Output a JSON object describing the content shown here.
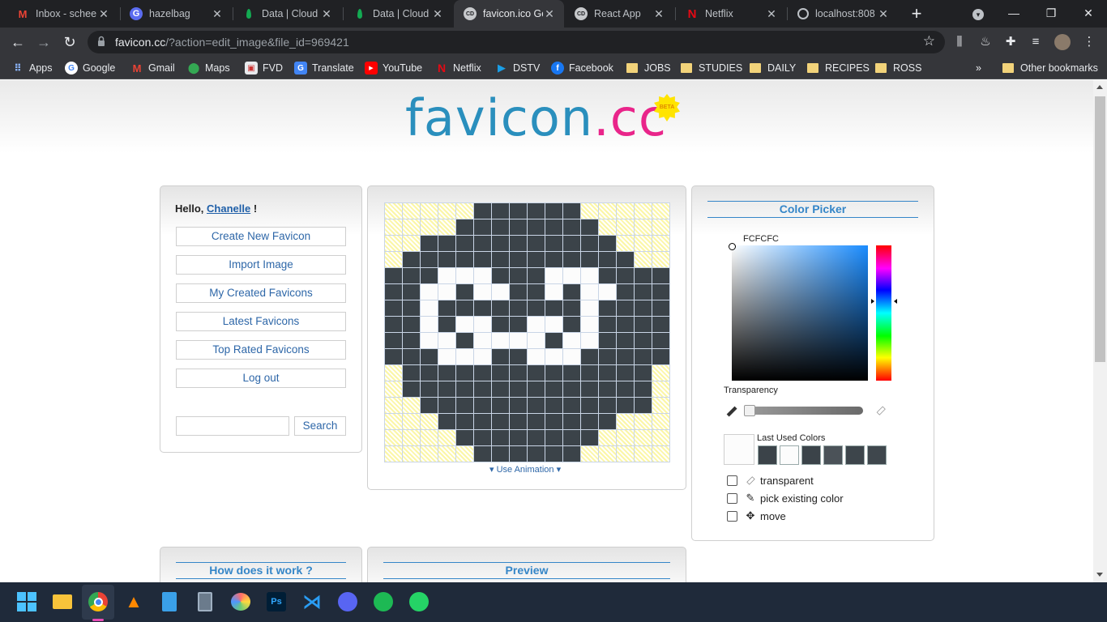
{
  "browser": {
    "tabs": [
      {
        "title": "Inbox - schee",
        "icon": "gmail-icon"
      },
      {
        "title": "hazelbag",
        "icon": "hazelbag-icon"
      },
      {
        "title": "Data | Cloud",
        "icon": "mongodb-leaf-icon"
      },
      {
        "title": "Data | Cloud",
        "icon": "mongodb-leaf-icon"
      },
      {
        "title": "favicon.ico Ge",
        "icon": "favicon-cc-icon",
        "active": true
      },
      {
        "title": "React App",
        "icon": "react-app-icon"
      },
      {
        "title": "Netflix",
        "icon": "netflix-icon"
      },
      {
        "title": "localhost:808",
        "icon": "globe-icon"
      }
    ],
    "url_host": "favicon.cc",
    "url_path": "/?action=edit_image&file_id=969421",
    "bookmarks": [
      {
        "label": "Apps",
        "icon": "apps-grid-icon"
      },
      {
        "label": "Google",
        "icon": "google-icon"
      },
      {
        "label": "Gmail",
        "icon": "gmail-icon"
      },
      {
        "label": "Maps",
        "icon": "maps-icon"
      },
      {
        "label": "FVD",
        "icon": "fvd-icon"
      },
      {
        "label": "Translate",
        "icon": "translate-icon"
      },
      {
        "label": "YouTube",
        "icon": "youtube-icon"
      },
      {
        "label": "Netflix",
        "icon": "netflix-icon"
      },
      {
        "label": "DSTV",
        "icon": "dstv-icon"
      },
      {
        "label": "Facebook",
        "icon": "facebook-icon"
      },
      {
        "label": "JOBS",
        "icon": "folder-icon"
      },
      {
        "label": "STUDIES",
        "icon": "folder-icon"
      },
      {
        "label": "DAILY",
        "icon": "folder-icon"
      },
      {
        "label": "RECIPES",
        "icon": "folder-icon"
      },
      {
        "label": "ROSS",
        "icon": "folder-icon"
      }
    ],
    "bookmarks_overflow": "»",
    "other_bookmarks": "Other bookmarks"
  },
  "logo": {
    "part1": "favicon",
    "dot": ".",
    "part2": "cc",
    "badge": "BETA"
  },
  "user_panel": {
    "hello_prefix": "Hello, ",
    "username": "Chanelle",
    "hello_suffix": " !",
    "menu": [
      "Create New Favicon",
      "Import Image",
      "My Created Favicons",
      "Latest Favicons",
      "Top Rated Favicons",
      "Log out"
    ],
    "search_placeholder": "",
    "search_button": "Search"
  },
  "editor": {
    "use_animation": "Use Animation",
    "pixels": [
      "tttttddddddttttt",
      "ttttddddddddtttt",
      "ttdddddddddddttt",
      "tdddddddddddddtt",
      "dddwwwdddwwwdddd",
      "ddwwdwwddwdwwddd",
      "ddwddddddddwdddd",
      "ddwdwwddwwdwdddd",
      "ddwwdwwwwdwwdddd",
      "dddwwwddwwwddddd",
      "tddddddddddddddt",
      "tddddddddddddddt",
      "ttdddddddddddddt",
      "tttddddddddddttt",
      "ttttddddddddtttt",
      "tttttddddddttttt"
    ]
  },
  "color_picker": {
    "title": "Color Picker",
    "hex": "FCFCFC",
    "transparency_label": "Transparency",
    "last_used_label": "Last Used Colors",
    "last_used": [
      "#3b4349",
      "#fcfcfc",
      "#3b4349",
      "#4b5258",
      "#3d454b",
      "#3f474d"
    ],
    "options": [
      {
        "label": "transparent",
        "icon": "eraser-icon"
      },
      {
        "label": "pick existing color",
        "icon": "eyedropper-icon"
      },
      {
        "label": "move",
        "icon": "move-icon"
      }
    ]
  },
  "bottom": {
    "how_title": "How does it work ?",
    "preview_title": "Preview"
  }
}
